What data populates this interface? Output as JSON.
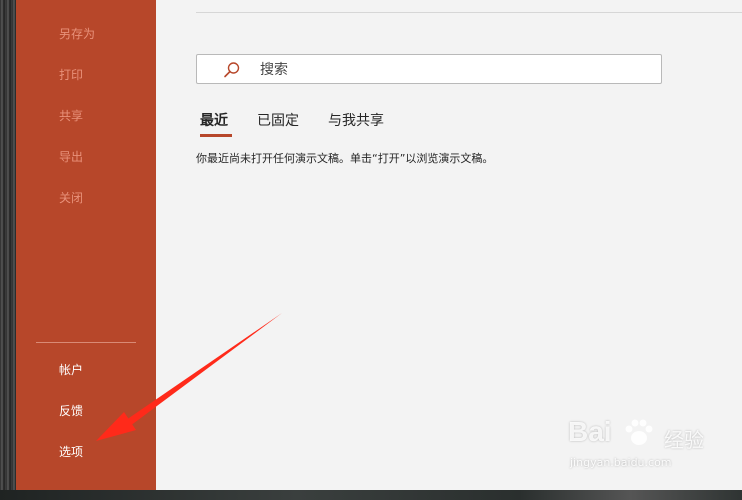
{
  "sidebar": {
    "items_top": [
      {
        "label": "另存为"
      },
      {
        "label": "打印"
      },
      {
        "label": "共享"
      },
      {
        "label": "导出"
      },
      {
        "label": "关闭"
      }
    ],
    "items_bottom": [
      {
        "label": "帐户"
      },
      {
        "label": "反馈"
      },
      {
        "label": "选项"
      }
    ],
    "color": "#b7472a"
  },
  "search": {
    "placeholder": "搜索"
  },
  "tabs": [
    {
      "label": "最近",
      "active": true
    },
    {
      "label": "已固定",
      "active": false
    },
    {
      "label": "与我共享",
      "active": false
    }
  ],
  "empty_message": "你最近尚未打开任何演示文稿。单击“打开”以浏览演示文稿。",
  "annotation": {
    "arrow_color": "#ff2a1a"
  },
  "watermark": {
    "brand": "Bai",
    "brand_suffix": "经验",
    "url": "jingyan.baidu.com"
  }
}
